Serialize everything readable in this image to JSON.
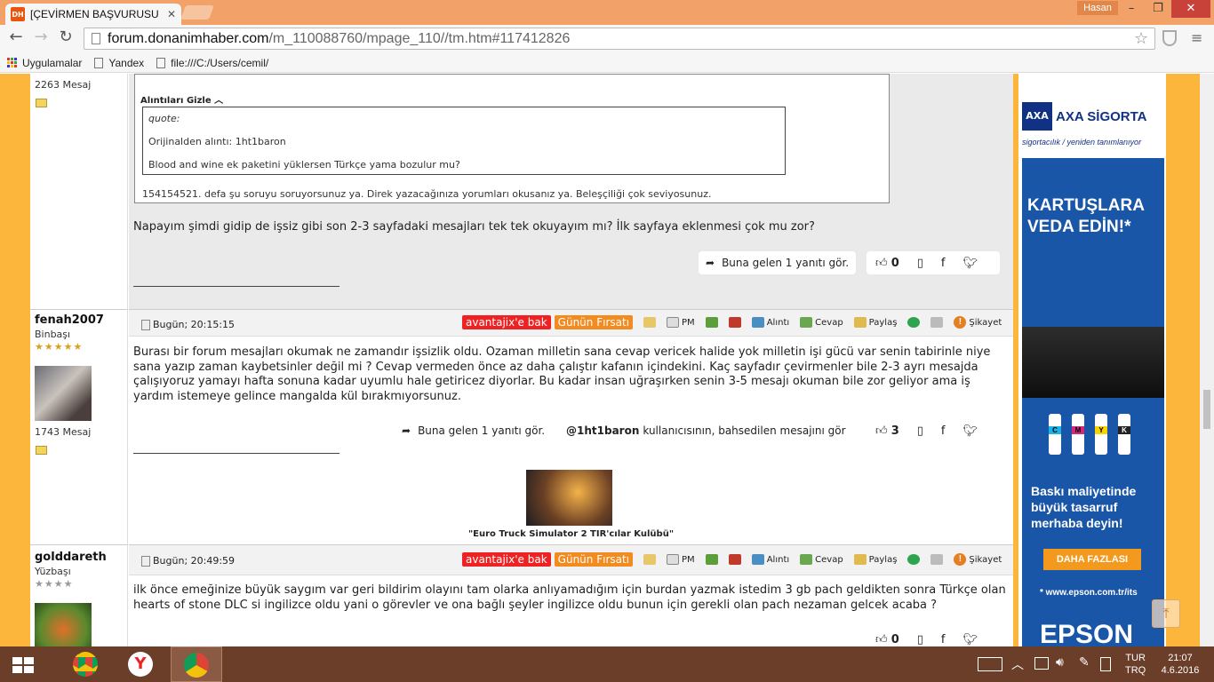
{
  "browser": {
    "tab_title": "[ÇEVİRMEN BAŞVURUSU /",
    "favicon_text": "DH",
    "user": "Hasan",
    "url_domain": "forum.donanimhaber.com",
    "url_path": "/m_110088760/mpage_110//tm.htm#117412826",
    "bookmarks": [
      "Uygulamalar",
      "Yandex",
      "file:///C:/Users/cemil/"
    ]
  },
  "post1": {
    "mesaj": "2263 Mesaj",
    "quote_toggle": "Alıntıları Gizle",
    "quote_label": "quote:",
    "quote_origin": "Orijinalden alıntı: 1ht1baron",
    "quote_text": "Blood and wine ek paketini yüklersen Türkçe yama bozulur mu?",
    "outer_quote_text": "154154521. defa şu soruyu soruyorsunuz ya. Direk yazacağınıza yorumları okusanız ya. Beleşçiliği çok seviyosunuz.",
    "body": "Napayım şimdi gidip de işsiz gibi son 2-3 sayfadaki mesajları tek tek okuyayım mı? İlk sayfaya eklenmesi çok mu zor?",
    "reply_btn": "Buna gelen 1 yanıtı gör.",
    "likes": "0"
  },
  "post2": {
    "username": "fenah2007",
    "rank": "Binbaşı",
    "stars": "★★★★★",
    "mesaj": "1743 Mesaj",
    "date": "Bugün; 20:15:15",
    "avantaj": "avantajix'e bak",
    "firsat": "Günün Fırsatı",
    "actions": [
      "PM",
      "Alıntı",
      "Cevap",
      "Paylaş",
      "Şikayet"
    ],
    "body": "Burası bir forum mesajları okumak ne zamandır işsizlik oldu. Ozaman milletin sana cevap vericek halide yok milletin işi gücü var senin tabirinle niye sana yazıp zaman kaybetsinler değil mi ? Cevap vermeden önce az daha çalıştır kafanın içindekini. Kaç sayfadır çevirmenler bile 2-3 ayrı mesajda çalışıyoruz yamayı hafta sonuna kadar uyumlu hale getiricez diyorlar. Bu kadar insan uğraşırken senin 3-5 mesajı okuman bile zor geliyor ama iş yardım istemeye gelince mangalda kül bırakmıyorsunuz.",
    "reply_btn": "Buna gelen 1 yanıtı gör.",
    "mention_user": "@1ht1baron",
    "mention_text": "kullanıcısının, bahsedilen mesajını gör",
    "likes": "3",
    "club": "\"Euro Truck Simulator 2 TIR'cılar Kulübü\""
  },
  "post3": {
    "username": "golddareth",
    "rank": "Yüzbaşı",
    "stars": "★★★★",
    "date": "Bugün; 20:49:59",
    "avantaj": "avantajix'e bak",
    "firsat": "Günün Fırsatı",
    "actions": [
      "PM",
      "Alıntı",
      "Cevap",
      "Paylaş",
      "Şikayet"
    ],
    "body": "ilk önce emeğinize büyük saygım var geri bildirim olayını tam olarka anlıyamadığım için burdan yazmak istedim 3 gb pach geldikten sonra Türkçe olan hearts of stone DLC si ingilizce oldu yani o görevler ve ona bağlı şeyler ingilizce oldu bunun için gerekli olan pach nezaman gelcek acaba ?",
    "likes": "0"
  },
  "ad": {
    "axa": "AXA SİGORTA",
    "axa_sub": "sigortacılık / yeniden tanımlanıyor",
    "headline": "KARTUŞLARA VEDA EDİN!*",
    "sub": "Baskı maliyetinde büyük tasarruf merhaba deyin!",
    "cta": "DAHA FAZLASI",
    "site": "* www.epson.com.tr/its",
    "brand": "EPSON",
    "ink_labels": [
      "C",
      "M",
      "Y",
      "K"
    ]
  },
  "taskbar": {
    "lang": "TUR",
    "lang2": "TRQ",
    "time": "21:07",
    "date": "4.6.2016"
  },
  "colors": {
    "page_bg": "#fbb63b",
    "title_bar": "#f2a168",
    "taskbar": "#6b3e2a",
    "ad_blue": "#1a56a8"
  }
}
